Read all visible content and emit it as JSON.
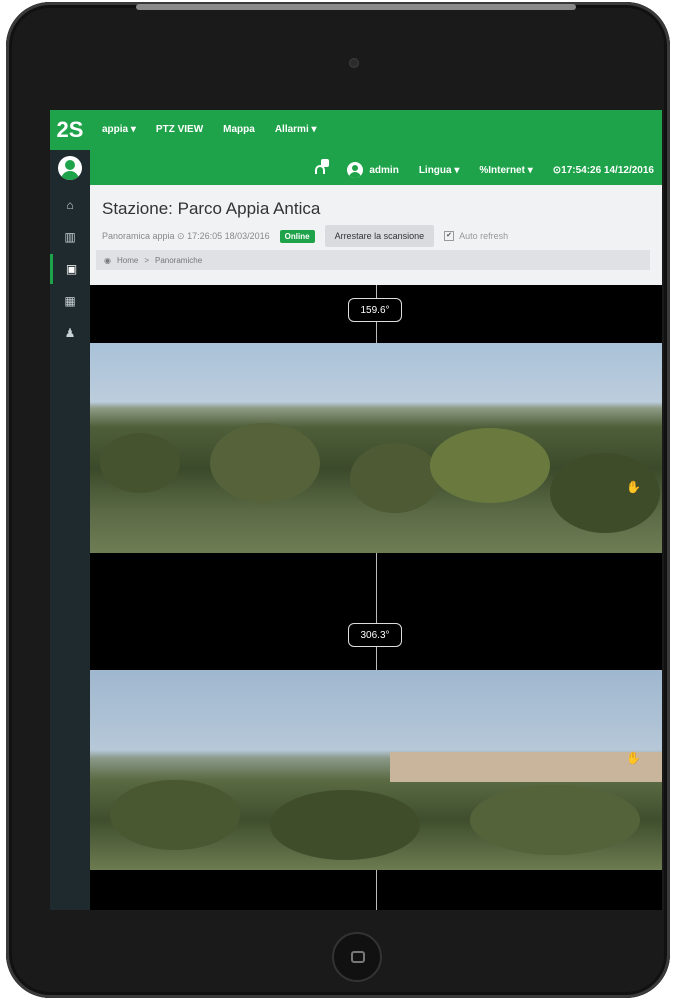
{
  "topnav": {
    "station_menu": "appia ▾",
    "ptz": "PTZ VIEW",
    "map": "Mappa",
    "alarms": "Allarmi ▾"
  },
  "usernav": {
    "user": "admin",
    "language": "Lingua ▾",
    "internet": "%Internet ▾",
    "clock": "⊙17:54:26 14/12/2016"
  },
  "brand": {
    "logo_text": "2S"
  },
  "header": {
    "title": "Stazione: Parco Appia Antica",
    "subtitle": "Panoramica appia ⊙ 17:26:05 18/03/2016",
    "status": "Online",
    "stop_label": "Arrestare la scansione",
    "auto_refresh": "Auto refresh"
  },
  "breadcrumb": {
    "home": "Home",
    "separator": ">",
    "current": "Panoramiche"
  },
  "panoramas": [
    {
      "angle": "159.6°"
    },
    {
      "angle": "306.3°"
    }
  ],
  "colors": {
    "accent": "#1fa34a",
    "sidebar": "#1f2a2e"
  }
}
